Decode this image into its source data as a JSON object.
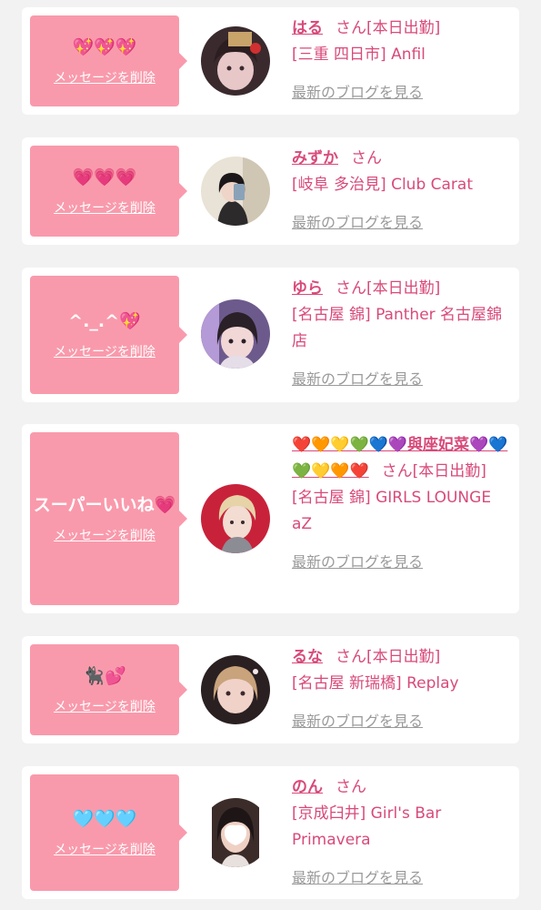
{
  "entries": [
    {
      "message": "💖💖💖",
      "delete_label": "メッセージを削除",
      "name": "はる",
      "honorific": "さん",
      "status": "[本日出勤]",
      "shop": "[三重 四日市] Anfil",
      "blog_label": "最新のブログを見る"
    },
    {
      "message": "💗💗💗",
      "delete_label": "メッセージを削除",
      "name": "みずか",
      "honorific": "さん",
      "status": "",
      "shop": "[岐阜 多治見] Club Carat",
      "blog_label": "最新のブログを見る"
    },
    {
      "message": "^._.^💖",
      "delete_label": "メッセージを削除",
      "name": "ゆら",
      "honorific": "さん",
      "status": "[本日出勤]",
      "shop": "[名古屋 錦] Panther 名古屋錦店",
      "blog_label": "最新のブログを見る"
    },
    {
      "message": "スーパーいいね💗",
      "delete_label": "メッセージを削除",
      "name": "❤️🧡💛💚💙💜與座妃菜💜💙💚💛🧡❤️",
      "honorific": "さん",
      "status": "[本日出勤]",
      "shop": "[名古屋 錦] GIRLS LOUNGE aZ",
      "blog_label": "最新のブログを見る"
    },
    {
      "message": "🐈‍⬛💕",
      "delete_label": "メッセージを削除",
      "name": "るな",
      "honorific": "さん",
      "status": "[本日出勤]",
      "shop": "[名古屋 新瑞橋] Replay",
      "blog_label": "最新のブログを見る"
    },
    {
      "message": "🩵🩵🩵",
      "delete_label": "メッセージを削除",
      "name": "のん",
      "honorific": "さん",
      "status": "",
      "shop": "[京成臼井] Girl's Bar Primavera",
      "blog_label": "最新のブログを見る"
    }
  ],
  "colors": {
    "page_background": "#f2f2f2",
    "card_background": "#ffffff",
    "message_box": "#f99aac",
    "name_text": "#d84a7a",
    "blog_link": "#9a9a9a"
  },
  "icons": [
    "profile-photo-avatar"
  ]
}
